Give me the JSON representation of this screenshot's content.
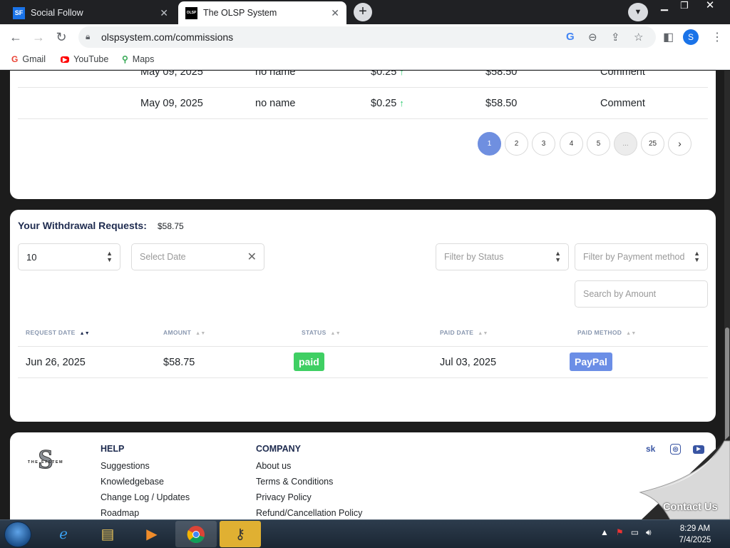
{
  "browser": {
    "tabs": [
      {
        "title": "Social Follow",
        "favicon_text": "SF"
      },
      {
        "title": "The OLSP System",
        "favicon_text": "OLSP"
      }
    ],
    "url": "olspsystem.com/commissions",
    "profile_initial": "S",
    "bookmarks": [
      "Gmail",
      "YouTube",
      "Maps"
    ]
  },
  "commissions": {
    "rows": [
      {
        "date": "May 09, 2025",
        "name": "no name",
        "amount": "$0.25",
        "total": "$58.50",
        "type": "Comment"
      },
      {
        "date": "May 09, 2025",
        "name": "no name",
        "amount": "$0.25",
        "total": "$58.50",
        "type": "Comment"
      }
    ],
    "pagination": [
      "1",
      "2",
      "3",
      "4",
      "5",
      "...",
      "25"
    ],
    "current_page": "1"
  },
  "withdrawals": {
    "title": "Your Withdrawal Requests:",
    "total": "$58.75",
    "per_page": "10",
    "date_placeholder": "Select Date",
    "status_filter_placeholder": "Filter by Status",
    "payment_filter_placeholder": "Filter by Payment method",
    "amount_search_placeholder": "Search by Amount",
    "columns": [
      "REQUEST DATE",
      "AMOUNT",
      "STATUS",
      "PAID DATE",
      "PAID METHOD"
    ],
    "rows": [
      {
        "request_date": "Jun 26, 2025",
        "amount": "$58.75",
        "status": "paid",
        "paid_date": "Jul 03, 2025",
        "method": "PayPal"
      }
    ]
  },
  "footer": {
    "logo_text": "THE SYSTEM",
    "help": {
      "title": "HELP",
      "links": [
        "Suggestions",
        "Knowledgebase",
        "Change Log / Updates",
        "Roadmap"
      ]
    },
    "company": {
      "title": "COMPANY",
      "links": [
        "About us",
        "Terms & Conditions",
        "Privacy Policy",
        "Refund/Cancellation Policy"
      ]
    },
    "social": [
      "sk",
      "instagram-icon",
      "youtube-icon"
    ],
    "contact_label": "Contact Us"
  },
  "taskbar": {
    "time": "8:29 AM",
    "date": "7/4/2025"
  },
  "colors": {
    "accent": "#6f8fe0",
    "paid": "#3fcf63",
    "paypal": "#6b8ee6",
    "heading": "#1e2b4f"
  }
}
